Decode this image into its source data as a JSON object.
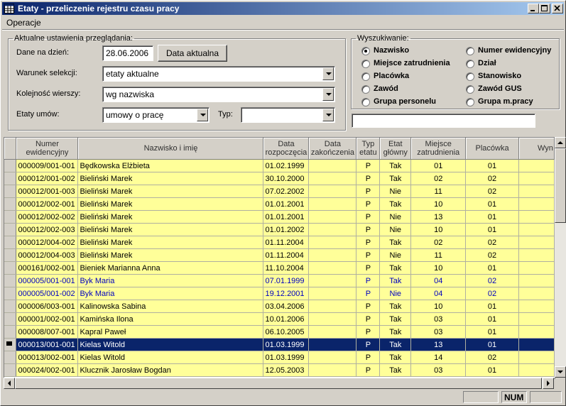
{
  "window": {
    "title": "Etaty - przeliczenie rejestru czasu pracy"
  },
  "menu": {
    "items": [
      "Operacje"
    ]
  },
  "settings": {
    "legend": "Aktualne ustawienia przeglądania:",
    "date_label": "Dane na dzień:",
    "date_value": "28.06.2006",
    "date_button": "Data aktualna",
    "condition_label": "Warunek selekcji:",
    "condition_value": "etaty aktualne",
    "order_label": "Kolejność wierszy:",
    "order_value": "wg nazwiska",
    "contracts_label": "Etaty umów:",
    "contracts_value": "umowy o pracę",
    "type_label": "Typ:",
    "type_value": ""
  },
  "search": {
    "legend": "Wyszukiwanie:",
    "options": [
      "Nazwisko",
      "Numer ewidencyjny",
      "Miejsce zatrudnienia",
      "Dział",
      "Placówka",
      "Stanowisko",
      "Zawód",
      "Zawód GUS",
      "Grupa personelu",
      "Grupa m.pracy"
    ],
    "selected": "Nazwisko",
    "query": ""
  },
  "table": {
    "columns": [
      "Numer ewidencyjny",
      "Nazwisko i imię",
      "Data rozpoczęcia",
      "Data zakończenia",
      "Typ etatu",
      "Etat główny",
      "Miejsce zatrudnienia",
      "Placówka",
      "Wyn"
    ],
    "rows": [
      [
        "000009/001-001",
        "Będkowska Elżbieta",
        "01.02.1999",
        "",
        "P",
        "Tak",
        "01",
        "01"
      ],
      [
        "000012/001-002",
        "Bieliński Marek",
        "30.10.2000",
        "",
        "P",
        "Tak",
        "02",
        "02"
      ],
      [
        "000012/001-003",
        "Bieliński Marek",
        "07.02.2002",
        "",
        "P",
        "Nie",
        "11",
        "02"
      ],
      [
        "000012/002-001",
        "Bieliński Marek",
        "01.01.2001",
        "",
        "P",
        "Tak",
        "10",
        "01"
      ],
      [
        "000012/002-002",
        "Bieliński Marek",
        "01.01.2001",
        "",
        "P",
        "Nie",
        "13",
        "01"
      ],
      [
        "000012/002-003",
        "Bieliński Marek",
        "01.01.2002",
        "",
        "P",
        "Nie",
        "10",
        "01"
      ],
      [
        "000012/004-002",
        "Bieliński Marek",
        "01.11.2004",
        "",
        "P",
        "Tak",
        "02",
        "02"
      ],
      [
        "000012/004-003",
        "Bieliński Marek",
        "01.11.2004",
        "",
        "P",
        "Nie",
        "11",
        "02"
      ],
      [
        "000161/002-001",
        "Bieniek Marianna Anna",
        "11.10.2004",
        "",
        "P",
        "Tak",
        "10",
        "01"
      ],
      [
        "000005/001-001",
        "Byk Maria",
        "07.01.1999",
        "",
        "P",
        "Tak",
        "04",
        "02"
      ],
      [
        "000005/001-002",
        "Byk Maria",
        "19.12.2001",
        "",
        "P",
        "Nie",
        "04",
        "02"
      ],
      [
        "000006/003-001",
        "Kalinowska Sabina",
        "03.04.2006",
        "",
        "P",
        "Tak",
        "10",
        "01"
      ],
      [
        "000001/002-001",
        "Kamińska Ilona",
        "10.01.2006",
        "",
        "P",
        "Tak",
        "03",
        "01"
      ],
      [
        "000008/007-001",
        "Kapral Paweł",
        "06.10.2005",
        "",
        "P",
        "Tak",
        "03",
        "01"
      ],
      [
        "000013/001-001",
        "Kielas Witold",
        "01.03.1999",
        "",
        "P",
        "Tak",
        "13",
        "01"
      ],
      [
        "000013/002-001",
        "Kielas Witold",
        "01.03.1999",
        "",
        "P",
        "Tak",
        "14",
        "02"
      ],
      [
        "000024/002-001",
        "Klucznik Jarosław Bogdan",
        "12.05.2003",
        "",
        "P",
        "Tak",
        "03",
        "01"
      ]
    ],
    "blue_rows": [
      9,
      10
    ],
    "selected_row": 14
  },
  "status": {
    "num": "NUM"
  }
}
